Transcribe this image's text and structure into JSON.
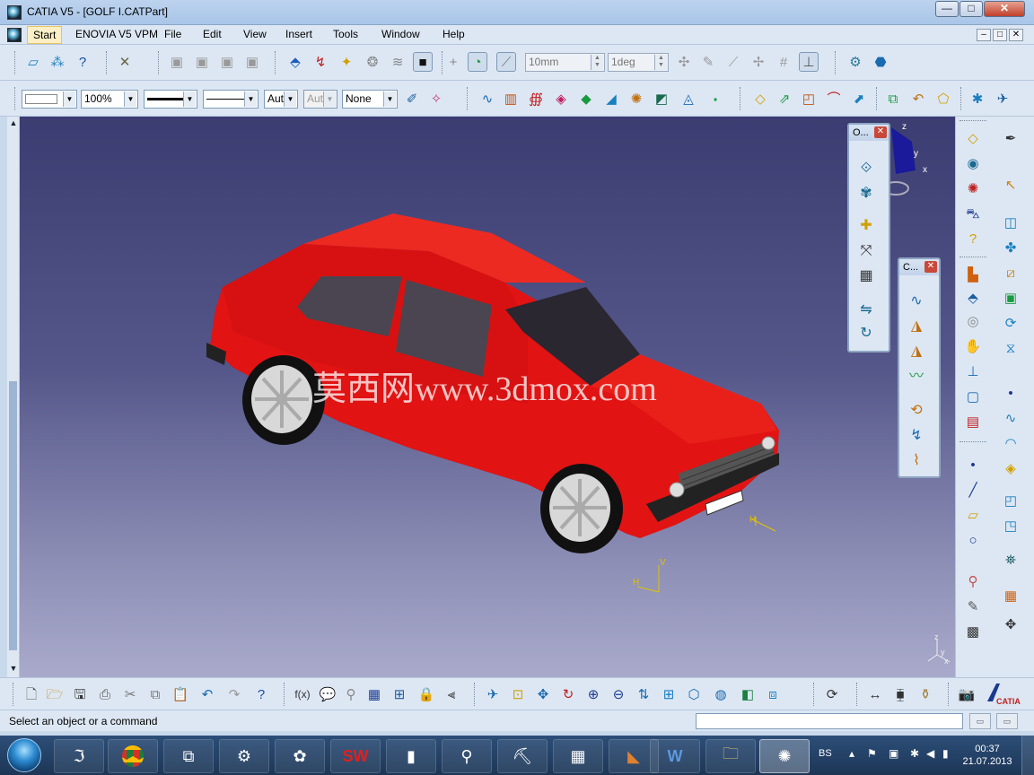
{
  "window": {
    "title": "CATIA V5 - [GOLF I.CATPart]",
    "buttons": {
      "minimize": "—",
      "maximize": "□",
      "close": "✕"
    }
  },
  "menu": {
    "items": [
      "Start",
      "ENOVIA V5 VPM",
      "File",
      "Edit",
      "View",
      "Insert",
      "Tools",
      "Window",
      "Help"
    ],
    "mdi_buttons": [
      "–",
      "□",
      "✕"
    ]
  },
  "toolbar1": {
    "snap_distance": "10mm",
    "snap_angle": "1deg"
  },
  "toolbar2": {
    "zoom": "100%",
    "line_auto_1": "Aut",
    "line_auto_2": "Aut",
    "layer": "None"
  },
  "viewport": {
    "watermark": "莫西网www.3dmox.com",
    "background_top": "#3b3d72",
    "background_bottom": "#a9aacb",
    "car_color": "#e01010",
    "compass_axes": [
      "z",
      "y",
      "x"
    ],
    "axis_labels": [
      "H",
      "V",
      "H"
    ],
    "corner_axes": [
      "z",
      "y",
      "x"
    ]
  },
  "panels": {
    "orientation": {
      "title": "O..."
    },
    "curves": {
      "title": "C..."
    }
  },
  "status": {
    "text": "Select an object or a command"
  },
  "brand": {
    "logo_text": "CATIA"
  },
  "taskbar": {
    "apps": [
      "catia",
      "chrome",
      "app",
      "gears",
      "app",
      "solidworks",
      "app",
      "app",
      "app",
      "app",
      "word",
      "explorer",
      "catia-active"
    ],
    "language": "BS",
    "time": "00:37",
    "date": "21.07.2013"
  }
}
